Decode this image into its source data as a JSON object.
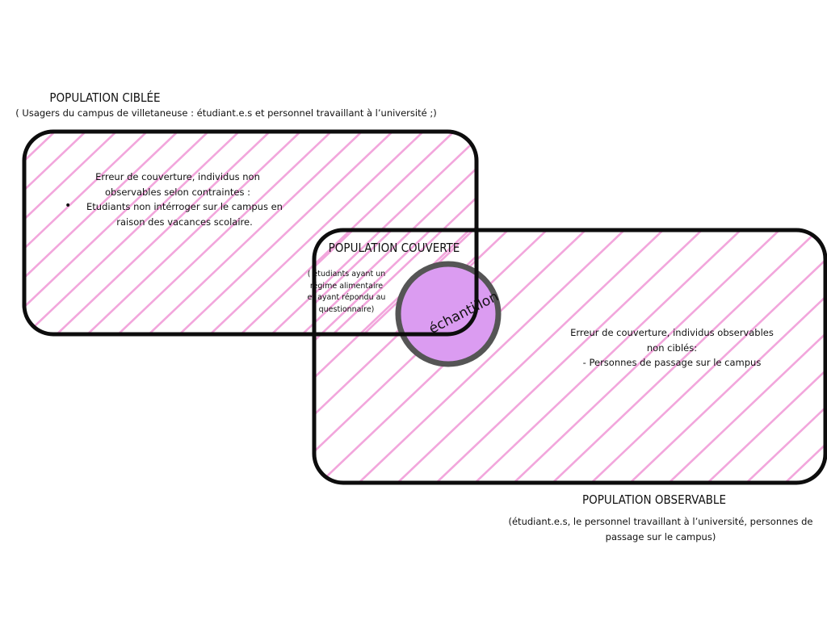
{
  "colors": {
    "hatch": "#f2a6dc",
    "outline": "#0d0d0d",
    "sample_fill": "#db9cf1",
    "sample_stroke": "#555555"
  },
  "targeted": {
    "title": "POPULATION CIBLÉE",
    "subtitle": "( Usagers du campus de villetaneuse :  étudiant.e.s et personnel travaillant à l’université ;)",
    "error_heading": "Erreur de couverture, individus non observables selon contraintes :",
    "error_bullet": "Etudiants non intérroger sur le campus en raison des vacances scolaire."
  },
  "covered": {
    "title": "POPULATION COUVERTE",
    "description": "( étudiants ayant un régime alimentaire et ayant répondu au questionnaire)"
  },
  "sample": {
    "label": "échantillon"
  },
  "observable": {
    "error_heading": "Erreur de couverture, individus observables non ciblés:",
    "error_item": "- Personnes de passage sur le campus",
    "title": "POPULATION OBSERVABLE",
    "subtitle": "(étudiant.e.s, le personnel travaillant à l’université, personnes de passage sur le campus)"
  }
}
